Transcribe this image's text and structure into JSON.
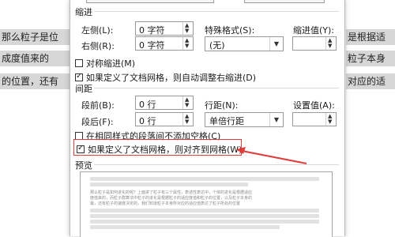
{
  "document": {
    "left_lines": [
      "那么粒子是位",
      "成度值来的",
      "的位置，还有"
    ],
    "right_lines": [
      "是根据适",
      "粒子本身",
      "对应的适"
    ]
  },
  "dialog": {
    "indent": {
      "section_title": "缩进",
      "left_label": "左侧(L):",
      "left_value": "0 字符",
      "right_label": "右侧(R):",
      "right_value": "0 字符",
      "special_label": "特殊格式(S):",
      "special_value": "(无)",
      "indent_value_label": "缩进值(Y):",
      "indent_value": "",
      "mirror_label": "对称缩进(M)",
      "mirror_checked": false,
      "auto_adjust_label": "如果定义了文档网格，则自动调整右缩进(D)",
      "auto_adjust_checked": true
    },
    "spacing": {
      "section_title": "间距",
      "before_label": "段前(B):",
      "before_value": "0 行",
      "after_label": "段后(F):",
      "after_value": "0 行",
      "line_label": "行距(N):",
      "line_value": "单倍行距",
      "setting_label": "设置值(A):",
      "setting_value": "",
      "no_space_label": "在相同样式的段落间不添加空格(C)",
      "no_space_checked": false,
      "snap_grid_label": "如果定义了文档网格，则对齐到网格(W)",
      "snap_grid_checked": true
    },
    "preview": {
      "section_title": "预览",
      "sample_line_1": "那么粒子是如何进化的呢？上面讲了粒子有三个属性，表述性表达中，个体的进化是根据适应",
      "sample_line_2": "度值来的，而粒子群算法中粒子的进化是根据粒子的适应度值和粒子的位置，以及粒子本身的",
      "sample_line_3": "最，还有粒子的速度决定的，我们知道粒子本身所对应的适应值表达了粒子所处的位置"
    }
  },
  "colors": {
    "annotation_red": "#e23b3b"
  }
}
